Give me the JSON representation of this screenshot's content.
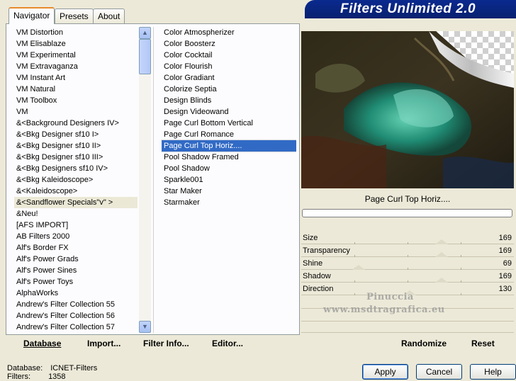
{
  "banner": {
    "title": "Filters Unlimited 2.0"
  },
  "tabs": [
    "Navigator",
    "Presets",
    "About"
  ],
  "categories": [
    "VM Distortion",
    "VM Elisablaze",
    "VM Experimental",
    "VM Extravaganza",
    "VM Instant Art",
    "VM Natural",
    "VM Toolbox",
    "VM",
    "&<Background Designers IV>",
    "&<Bkg Designer sf10 I>",
    "&<Bkg Designer sf10 II>",
    "&<Bkg Designer sf10 III>",
    "&<Bkg Designers sf10 IV>",
    "&<Bkg Kaleidoscope>",
    "&<Kaleidoscope>",
    "&<Sandflower Specials\"v\" >",
    "&Neu!",
    "[AFS IMPORT]",
    "AB Filters 2000",
    "Alf's Border FX",
    "Alf's Power Grads",
    "Alf's Power Sines",
    "Alf's Power Toys",
    "AlphaWorks",
    "Andrew's Filter Collection 55",
    "Andrew's Filter Collection 56",
    "Andrew's Filter Collection 57"
  ],
  "filters": [
    "Color Atmospherizer",
    "Color Boosterz",
    "Color Cocktail",
    "Color Flourish",
    "Color Gradiant",
    "Colorize Septia",
    "Design Blinds",
    "Design Videowand",
    "Page Curl Bottom Vertical",
    "Page Curl Romance",
    "Page Curl Top Horiz....",
    "Pool Shadow Framed",
    "Pool Shadow",
    "Sparkle001",
    "Star Maker",
    "Starmaker"
  ],
  "scrollbar": {
    "up": "▲",
    "down": "▼"
  },
  "bottom_left": {
    "database": "Database",
    "import": "Import...",
    "filter_info": "Filter Info...",
    "editor": "Editor..."
  },
  "selected_filter": "Page Curl Top Horiz....",
  "params": [
    {
      "label": "Size",
      "value": "169",
      "level": 0.66
    },
    {
      "label": "Transparency",
      "value": "169",
      "level": 0.66
    },
    {
      "label": "Shine",
      "value": "69",
      "level": 0.27
    },
    {
      "label": "Shadow",
      "value": "169",
      "level": 0.66
    },
    {
      "label": "Direction",
      "value": "130",
      "level": 0.51
    }
  ],
  "watermark": {
    "line1": "Pinuccia",
    "line2": "www.msdtragrafica.eu"
  },
  "bottom_right": {
    "randomize": "Randomize",
    "reset": "Reset"
  },
  "status": {
    "db_label": "Database:",
    "db_value": "ICNET-Filters",
    "filters_label": "Filters:",
    "filters_value": "1358"
  },
  "dialog": {
    "apply": "Apply",
    "cancel": "Cancel",
    "help": "Help"
  }
}
